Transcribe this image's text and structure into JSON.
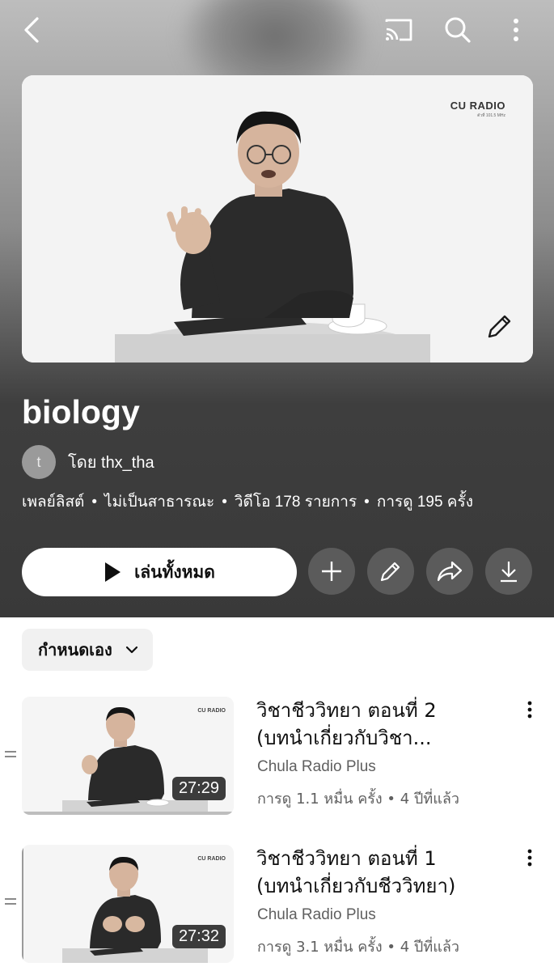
{
  "topbar": {
    "back_icon": "chevron-left-icon",
    "cast_icon": "cast-icon",
    "search_icon": "search-icon",
    "more_icon": "more-vert-icon"
  },
  "header": {
    "thumbnail_logo": "CU RADIO",
    "thumbnail_logo_sub": "ตัวที่ 101.5 MHz",
    "title": "biology",
    "owner_initial": "t",
    "owner_label": "โดย thx_tha",
    "meta": [
      "เพลย์ลิสต์",
      "ไม่เป็นสาธารณะ",
      "วิดีโอ 178 รายการ",
      "การดู 195 ครั้ง"
    ],
    "meta_separator": "•"
  },
  "actions": {
    "play_all_label": "เล่นทั้งหมด",
    "add_icon": "plus-icon",
    "edit_icon": "pencil-icon",
    "share_icon": "share-icon",
    "download_icon": "download-icon"
  },
  "sort": {
    "label": "กำหนดเอง"
  },
  "videos": [
    {
      "title_line1": "วิชาชีววิทยา ตอนที่ 2",
      "title_line2": "(บทนำเกี่ยวกับวิชา...",
      "channel": "Chula Radio Plus",
      "stats": "การดู 1.1 หมื่น ครั้ง • 4 ปีที่แล้ว",
      "duration": "27:29",
      "thumb_logo": "CU RADIO"
    },
    {
      "title_line1": "วิชาชีววิทยา ตอนที่ 1",
      "title_line2": "(บทนำเกี่ยวกับชีววิทยา)",
      "channel": "Chula Radio Plus",
      "stats": "การดู 3.1 หมื่น ครั้ง • 4 ปีที่แล้ว",
      "duration": "27:32",
      "thumb_logo": "CU RADIO"
    }
  ]
}
